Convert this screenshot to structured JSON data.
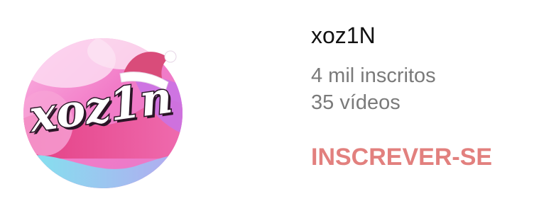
{
  "channel": {
    "name": "xoz1N",
    "subscribers": "4 mil inscritos",
    "videos": "35 vídeos",
    "subscribe_label": "INSCREVER-SE",
    "avatar_text": "xoz1n"
  },
  "colors": {
    "subscribe_accent": "#e2807e",
    "name_text": "#111111",
    "meta_text": "#7a7a7a",
    "avatar_pink": "#f27cc8",
    "avatar_magenta": "#e0317a",
    "avatar_cyan": "#6fe0ec",
    "santa_hat_red": "#d94c7a"
  },
  "icons": {
    "avatar_accessory": "santa-hat-icon"
  }
}
